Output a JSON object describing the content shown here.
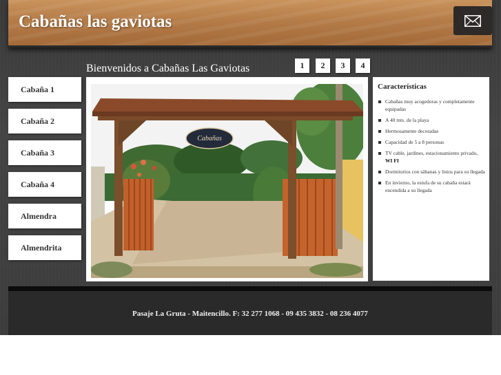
{
  "header": {
    "title": "Cabañas las gaviotas",
    "mail_icon": "envelope-icon"
  },
  "welcome": "Bienvenidos a Cabañas Las Gaviotas",
  "pager": [
    "1",
    "2",
    "3",
    "4"
  ],
  "nav": {
    "items": [
      {
        "label": "Cabaña 1"
      },
      {
        "label": "Cabaña 2"
      },
      {
        "label": "Cabaña 3"
      },
      {
        "label": "Cabaña 4"
      },
      {
        "label": "Almendra"
      },
      {
        "label": "Almendrita"
      }
    ]
  },
  "photo": {
    "sign_text": "Cabañas"
  },
  "features": {
    "title": "Características",
    "items": [
      "Cabañas muy acogedoras y completamente equipadas",
      "A 40 mts. de la playa",
      "Hermosamente decoradas",
      "Capacidad de 5 a 8 personas",
      "TV cable, jardines, estacionamiento privado,",
      "Dormitorios con sábanas y listos para su llegada",
      "En invierno, la estufa de su cabaña estará encendida a su llegada"
    ],
    "wifi": "WI FI"
  },
  "footer": {
    "text": "Pasaje La Gruta - Maitencillo. F: 32 277 1068 - 09 435 3832 - 08 236 4077"
  }
}
